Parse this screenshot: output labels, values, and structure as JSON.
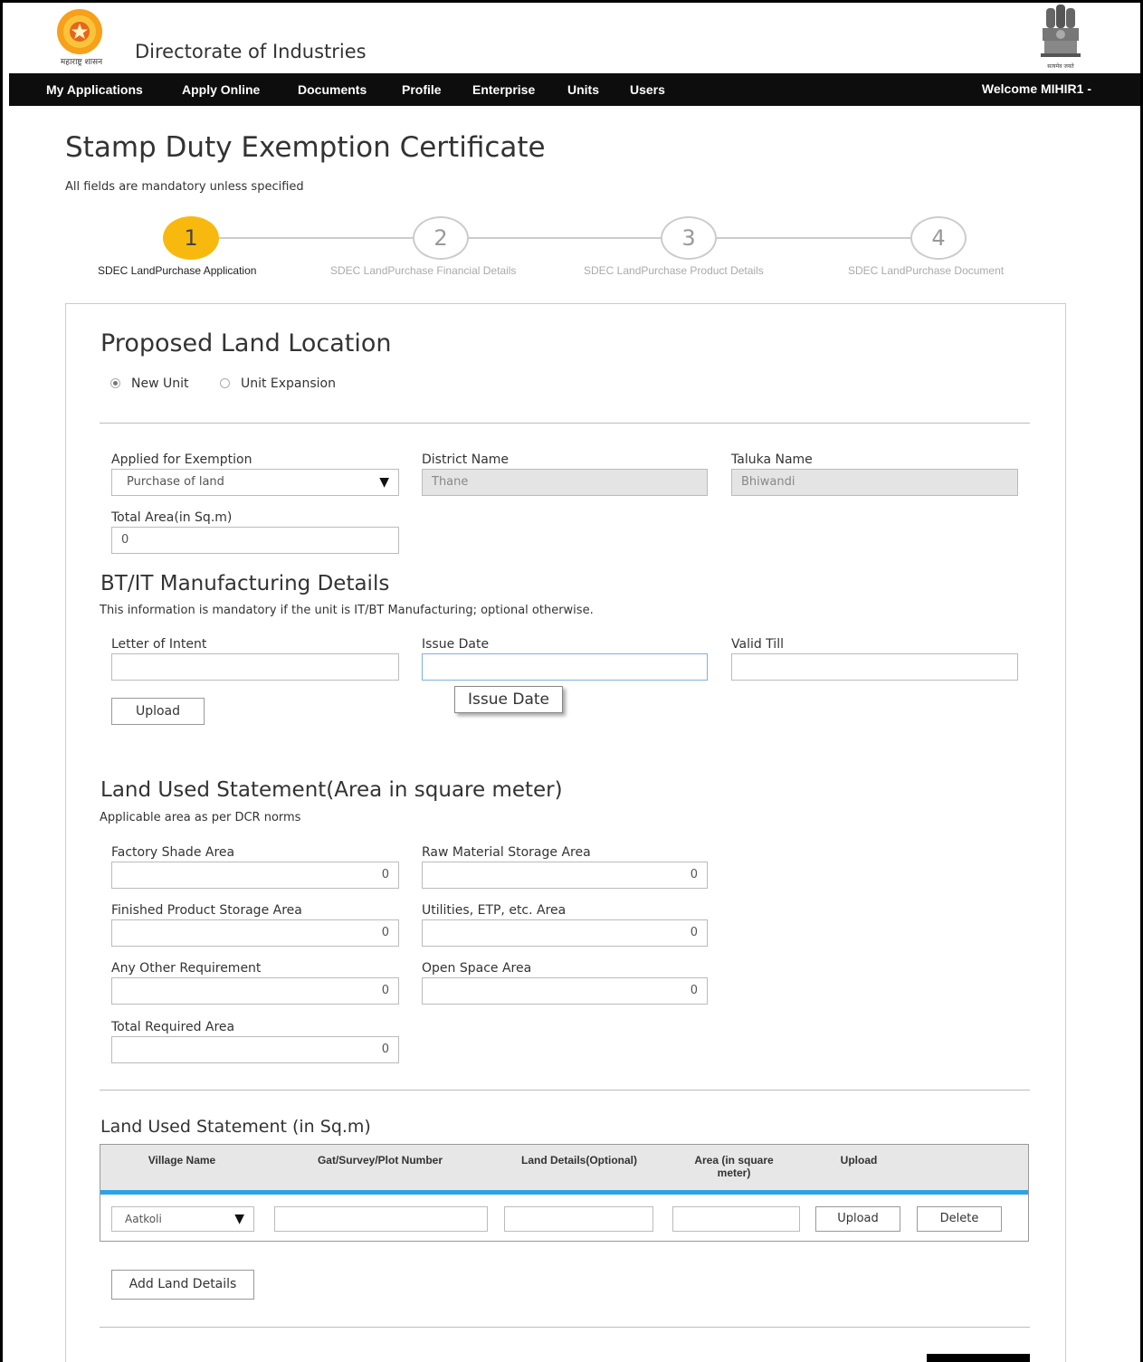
{
  "header": {
    "logo_text": "महाराष्ट्र शासन",
    "site_title": "Directorate of Industries",
    "emblem_text": "सत्यमेव जयते"
  },
  "nav": {
    "items": [
      "My Applications",
      "Apply Online",
      "Documents",
      "Profile",
      "Enterprise",
      "Units",
      "Users"
    ],
    "welcome": "Welcome MIHIR1 -"
  },
  "page": {
    "title": "Stamp Duty Exemption Certificate",
    "mandatory_note": "All fields are mandatory unless specified"
  },
  "wizard": {
    "steps": [
      {
        "number": "1",
        "label": "SDEC LandPurchase Application",
        "active": true
      },
      {
        "number": "2",
        "label": "SDEC LandPurchase Financial Details",
        "active": false
      },
      {
        "number": "3",
        "label": "SDEC LandPurchase Product Details",
        "active": false
      },
      {
        "number": "4",
        "label": "SDEC LandPurchase Document",
        "active": false
      }
    ]
  },
  "location": {
    "heading": "Proposed Land Location",
    "radio_new": "New Unit",
    "radio_expansion": "Unit Expansion",
    "selected": "New Unit",
    "applied_label": "Applied for Exemption",
    "applied_value": "Purchase of land",
    "district_label": "District Name",
    "district_value": "Thane",
    "taluka_label": "Taluka Name",
    "taluka_value": "Bhiwandi",
    "total_area_label": "Total Area(in Sq.m)",
    "total_area_value": "0"
  },
  "btit": {
    "heading": "BT/IT Manufacturing Details",
    "note": "This information is mandatory if the unit is IT/BT Manufacturing; optional otherwise.",
    "loi_label": "Letter of Intent",
    "issue_label": "Issue Date",
    "valid_label": "Valid Till",
    "upload_label": "Upload",
    "tooltip": "Issue Date"
  },
  "land_used": {
    "heading": "Land Used Statement(Area in square meter)",
    "note": "Applicable area as per DCR norms",
    "factory_label": "Factory Shade Area",
    "factory_value": "0",
    "raw_label": "Raw Material Storage Area",
    "raw_value": "0",
    "finished_label": "Finished Product Storage Area",
    "finished_value": "0",
    "utilities_label": "Utilities, ETP, etc. Area",
    "utilities_value": "0",
    "other_label": "Any Other Requirement",
    "other_value": "0",
    "open_label": "Open Space Area",
    "open_value": "0",
    "total_label": "Total Required Area",
    "total_value": "0"
  },
  "land_table": {
    "heading": "Land Used Statement (in Sq.m)",
    "columns": [
      "Village Name",
      "Gat/Survey/Plot Number",
      "Land Details(Optional)",
      "Area (in square meter)",
      "Upload"
    ],
    "row": {
      "village": "Aatkoli",
      "upload_label": "Upload",
      "delete_label": "Delete"
    },
    "add_label": "Add Land Details"
  },
  "colors": {
    "nav_bg": "#0d0d0d",
    "active_step": "#f8b90f",
    "table_accent": "#2aa4e6"
  }
}
